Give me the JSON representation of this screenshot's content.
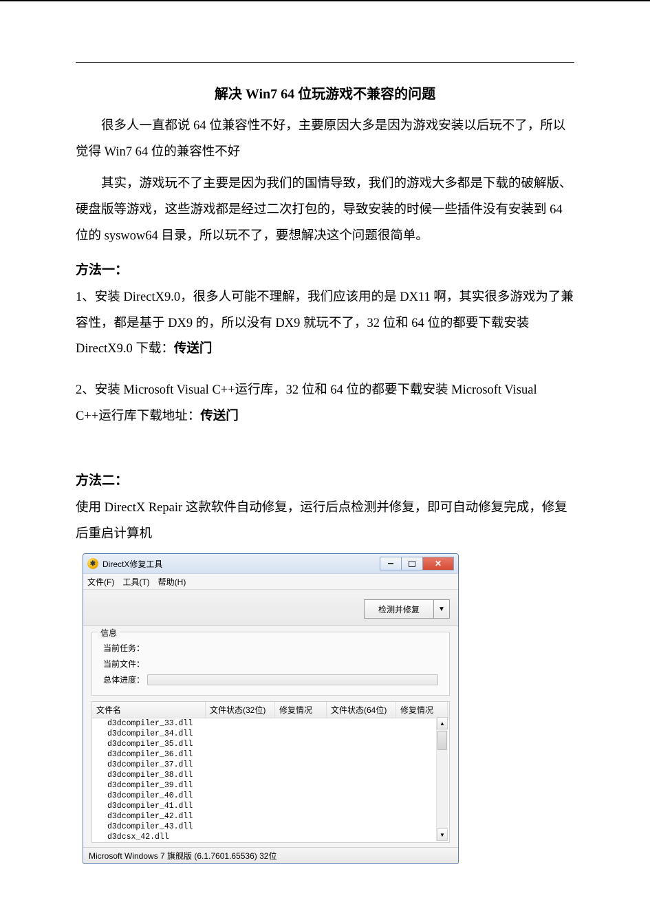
{
  "doc": {
    "title": "解决 Win7 64 位玩游戏不兼容的问题",
    "p1": "很多人一直都说 64 位兼容性不好，主要原因大多是因为游戏安装以后玩不了，所以觉得 Win7 64 位的兼容性不好",
    "p2": "其实，游戏玩不了主要是因为我们的国情导致，我们的游戏大多都是下载的破解版、硬盘版等游戏，这些游戏都是经过二次打包的，导致安装的时候一些插件没有安装到 64 位的 syswow64 目录，所以玩不了，要想解决这个问题很简单。",
    "method1_h": "方法一：",
    "m1_p1_a": "1、安装 DirectX9.0，很多人可能不理解，我们应该用的是 DX11 啊，其实很多游戏为了兼容性，都是基于 DX9 的，所以没有 DX9 就玩不了，32 位和 64 位的都要下载安装 DirectX9.0 下载：",
    "m1_p1_link": "传送门",
    "m1_p2_a": "2、安装 Microsoft Visual C++运行库，32 位和 64 位的都要下载安装 Microsoft Visual C++运行库下载地址：",
    "m1_p2_link": "传送门",
    "method2_h": "方法二：",
    "m2_p1": "使用 DirectX Repair 这款软件自动修复，运行后点检测并修复，即可自动修复完成，修复后重启计算机"
  },
  "win": {
    "title": "DirectX修复工具",
    "icon_char": "✱",
    "menu": {
      "file": "文件(F)",
      "tools": "工具(T)",
      "help": "帮助(H)"
    },
    "main_btn": "检测并修复",
    "dropdown_glyph": "▼",
    "group_label": "信息",
    "info": {
      "task_label": "当前任务：",
      "file_label": "当前文件：",
      "progress_label": "总体进度："
    },
    "table": {
      "col_name": "文件名",
      "col_s32": "文件状态(32位)",
      "col_fix1": "修复情况",
      "col_s64": "文件状态(64位)",
      "col_fix2": "修复情况",
      "rows": [
        "d3dcompiler_33.dll",
        "d3dcompiler_34.dll",
        "d3dcompiler_35.dll",
        "d3dcompiler_36.dll",
        "d3dcompiler_37.dll",
        "d3dcompiler_38.dll",
        "d3dcompiler_39.dll",
        "d3dcompiler_40.dll",
        "d3dcompiler_41.dll",
        "d3dcompiler_42.dll",
        "d3dcompiler_43.dll",
        "d3dcsx_42.dll"
      ]
    },
    "scroll": {
      "up": "▲",
      "down": "▼"
    },
    "status": "Microsoft Windows 7 旗舰版 (6.1.7601.65536) 32位"
  }
}
